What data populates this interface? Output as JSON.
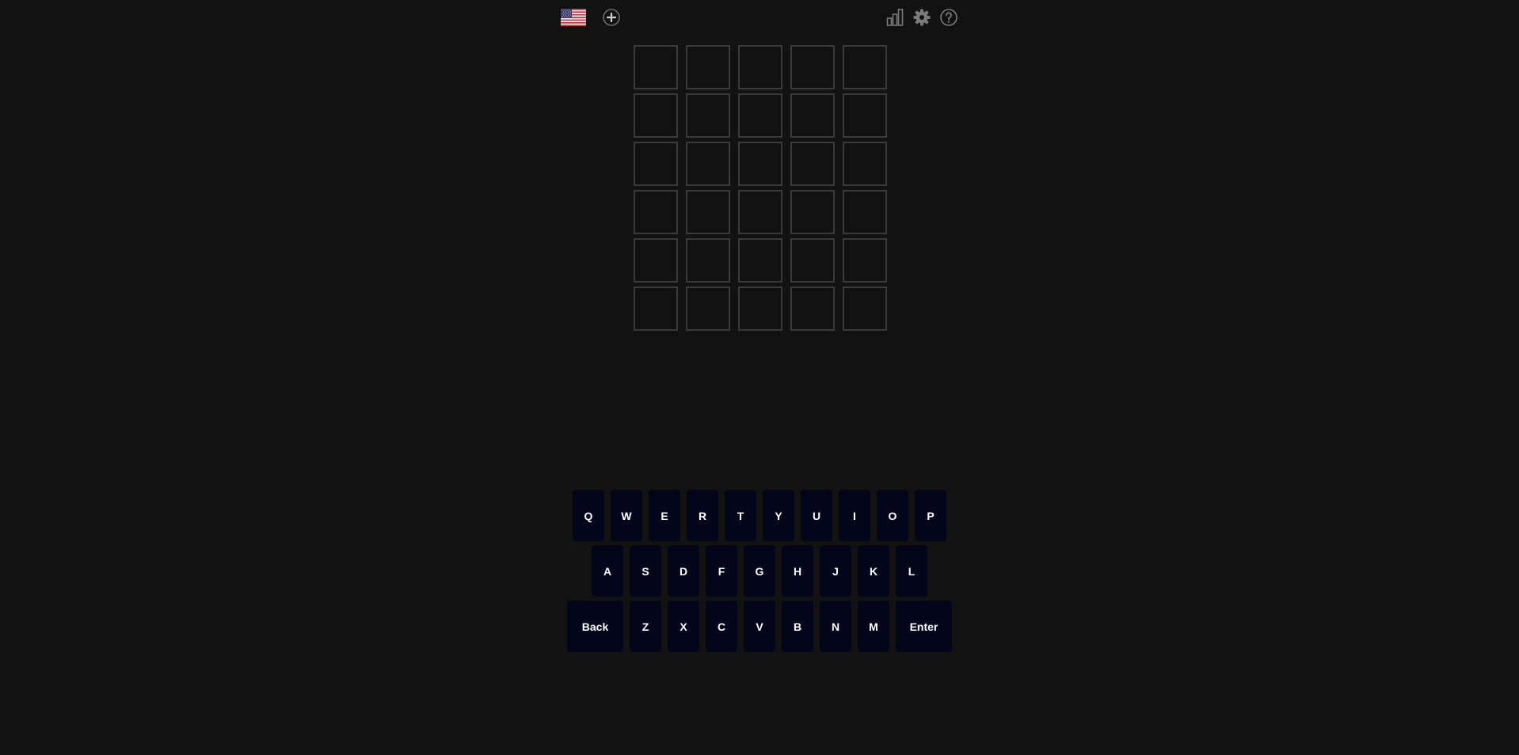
{
  "header": {
    "flag_icon": "us-flag-icon",
    "add_icon": "plus-circle-icon",
    "stats_icon": "bar-chart-icon",
    "settings_icon": "gear-icon",
    "help_icon": "question-circle-icon"
  },
  "board": {
    "rows": [
      [
        "",
        "",
        "",
        "",
        ""
      ],
      [
        "",
        "",
        "",
        "",
        ""
      ],
      [
        "",
        "",
        "",
        "",
        ""
      ],
      [
        "",
        "",
        "",
        "",
        ""
      ],
      [
        "",
        "",
        "",
        "",
        ""
      ],
      [
        "",
        "",
        "",
        "",
        ""
      ]
    ]
  },
  "keyboard": {
    "row1": [
      "Q",
      "W",
      "E",
      "R",
      "T",
      "Y",
      "U",
      "I",
      "O",
      "P"
    ],
    "row2": [
      "A",
      "S",
      "D",
      "F",
      "G",
      "H",
      "J",
      "K",
      "L"
    ],
    "row3": [
      "Z",
      "X",
      "C",
      "V",
      "B",
      "N",
      "M"
    ],
    "back_label": "Back",
    "enter_label": "Enter"
  },
  "colors": {
    "background": "#121212",
    "tile_border": "#3a3a3c",
    "key_background": "#03051a",
    "key_text": "#ffffff"
  }
}
